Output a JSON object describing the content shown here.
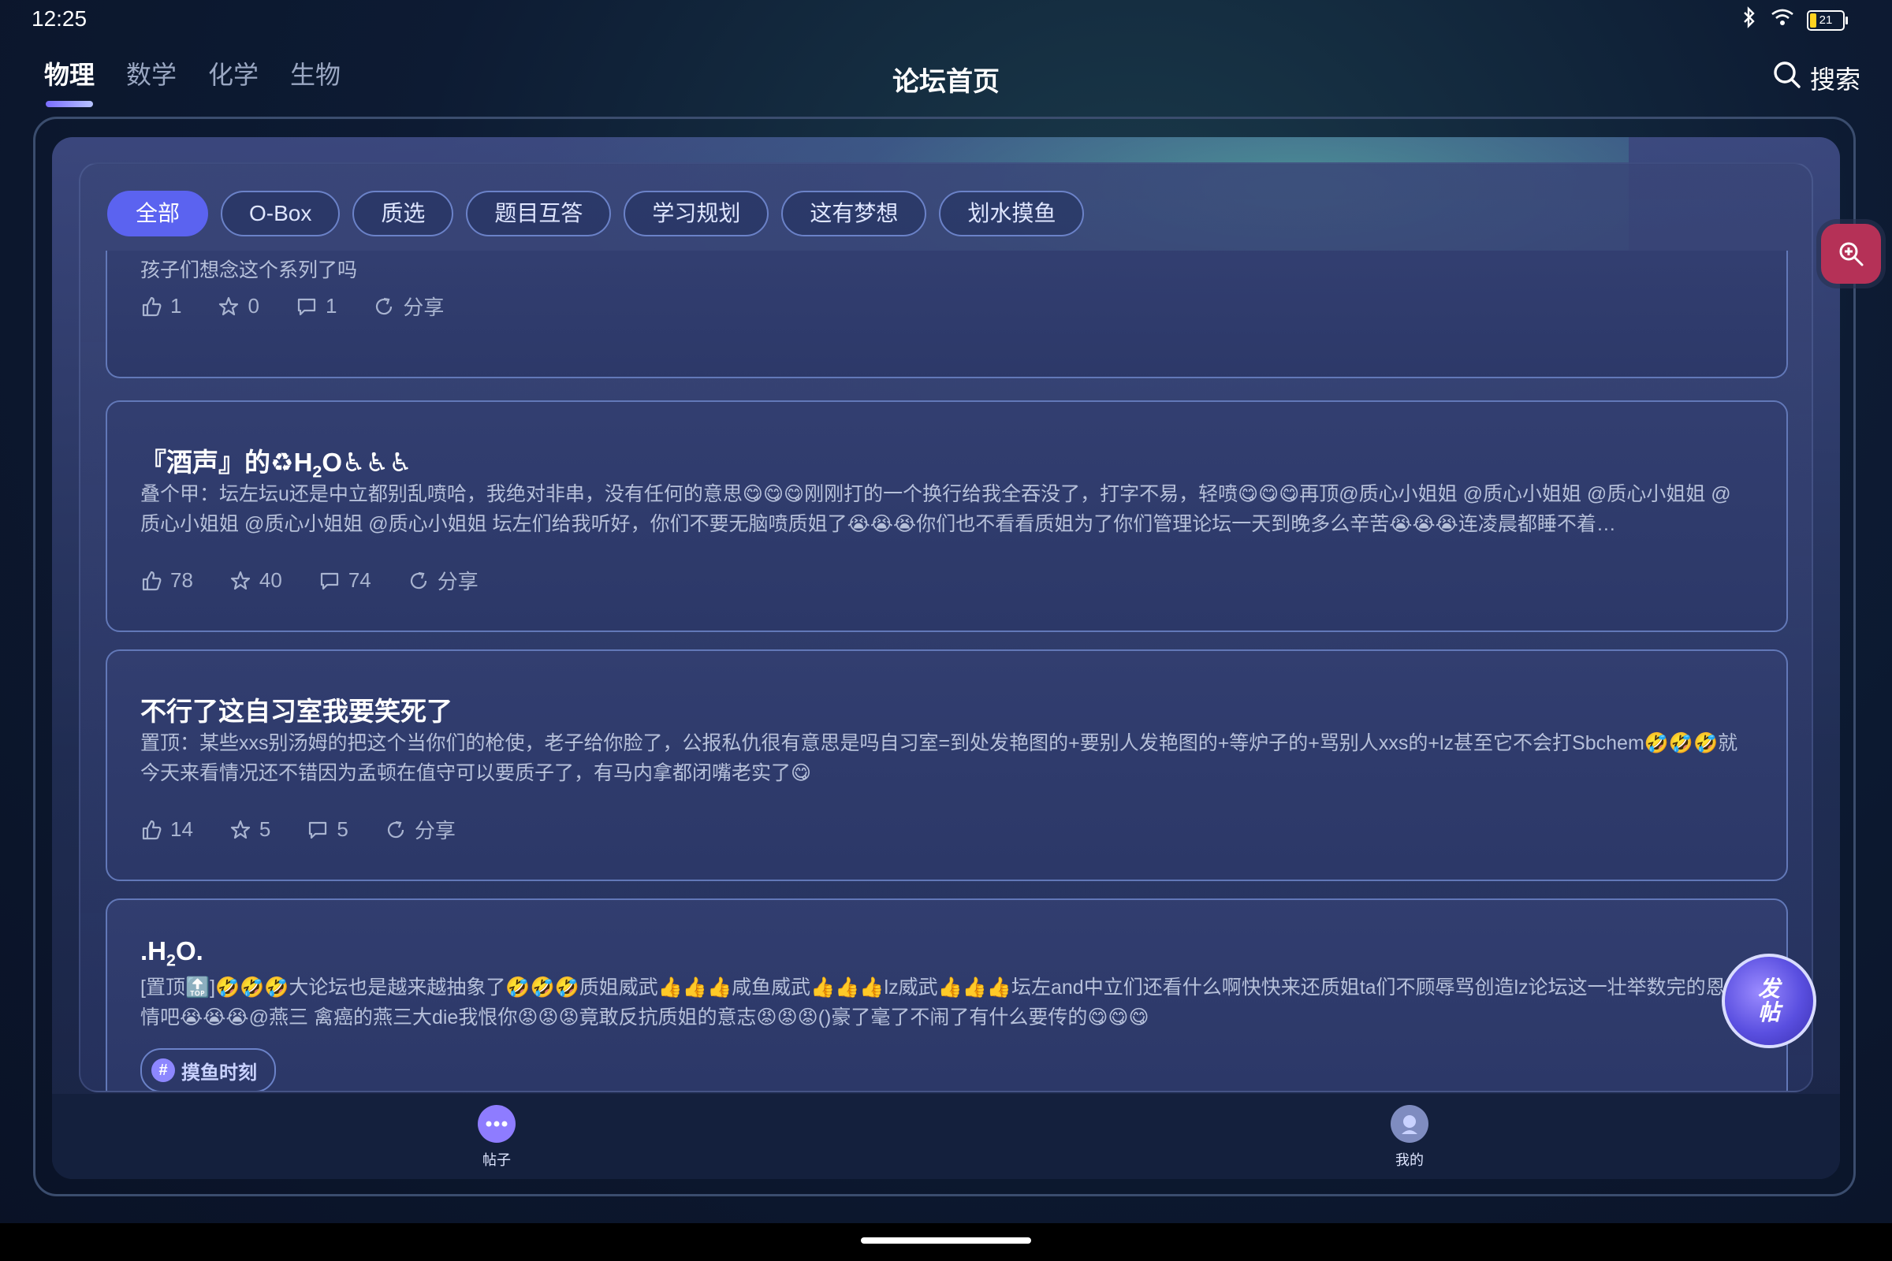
{
  "status_bar": {
    "time": "12:25",
    "battery": "21"
  },
  "header": {
    "subjects": [
      "物理",
      "数学",
      "化学",
      "生物"
    ],
    "title": "论坛首页",
    "search_label": "搜索"
  },
  "tabs": [
    "全部",
    "O-Box",
    "质选",
    "题目互答",
    "学习规划",
    "这有梦想",
    "划水摸鱼"
  ],
  "posts": [
    {
      "body": "孩子们想念这个系列了吗",
      "likes": "1",
      "stars": "0",
      "comments": "1",
      "share": "分享"
    },
    {
      "title_prefix": "『酒声』的♻H",
      "title_sub": "2",
      "title_suffix": "O♿♿♿",
      "body": "叠个甲：坛左坛u还是中立都别乱喷哈，我绝对非串，没有任何的意思😋😋😋刚刚打的一个换行给我全吞没了，打字不易，轻喷😋😋😋再顶@质心小姐姐 @质心小姐姐 @质心小姐姐 @质心小姐姐 @质心小姐姐 @质心小姐姐 坛左们给我听好，你们不要无脑喷质姐了😭😭😭你们也不看看质姐为了你们管理论坛一天到晚多么辛苦😭😭😭连凌晨都睡不着…",
      "likes": "78",
      "stars": "40",
      "comments": "74",
      "share": "分享"
    },
    {
      "title": "不行了这自习室我要笑死了",
      "body": "置顶：某些xxs别汤姆的把这个当你们的枪使，老子给你脸了，公报私仇很有意思是吗自习室=到处发艳图的+要别人发艳图的+等炉子的+骂别人xxs的+lz甚至它不会打Sbchem🤣🤣🤣就今天来看情况还不错因为孟顿在值守可以要质子了，有马内拿都闭嘴老实了😋",
      "likes": "14",
      "stars": "5",
      "comments": "5",
      "share": "分享"
    },
    {
      "title_prefix": ".H",
      "title_sub": "2",
      "title_suffix": "O.",
      "body": "[置顶🔝]🤣🤣🤣大论坛也是越来越抽象了🤣🤣🤣质姐威武👍👍👍咸鱼威武👍👍👍lz威武👍👍👍坛左and中立们还看什么啊快快来还质姐ta们不顾辱骂创造lz论坛这一壮举数完的恩情吧😭😭😭@燕三 禽癌的燕三大die我恨你😡😡😡竟敢反抗质姐的意志😡😡😡()豪了毫了不闹了有什么要传的😋😋😋",
      "tag": "摸鱼时刻"
    }
  ],
  "bottom_nav": {
    "posts": "帖子",
    "mine": "我的"
  },
  "fab": {
    "post_line1": "发",
    "post_line2": "帖"
  },
  "colors": {
    "accent": "#5b63f0",
    "zoom_fab": "#b53157",
    "card_border": "#6278b8"
  }
}
